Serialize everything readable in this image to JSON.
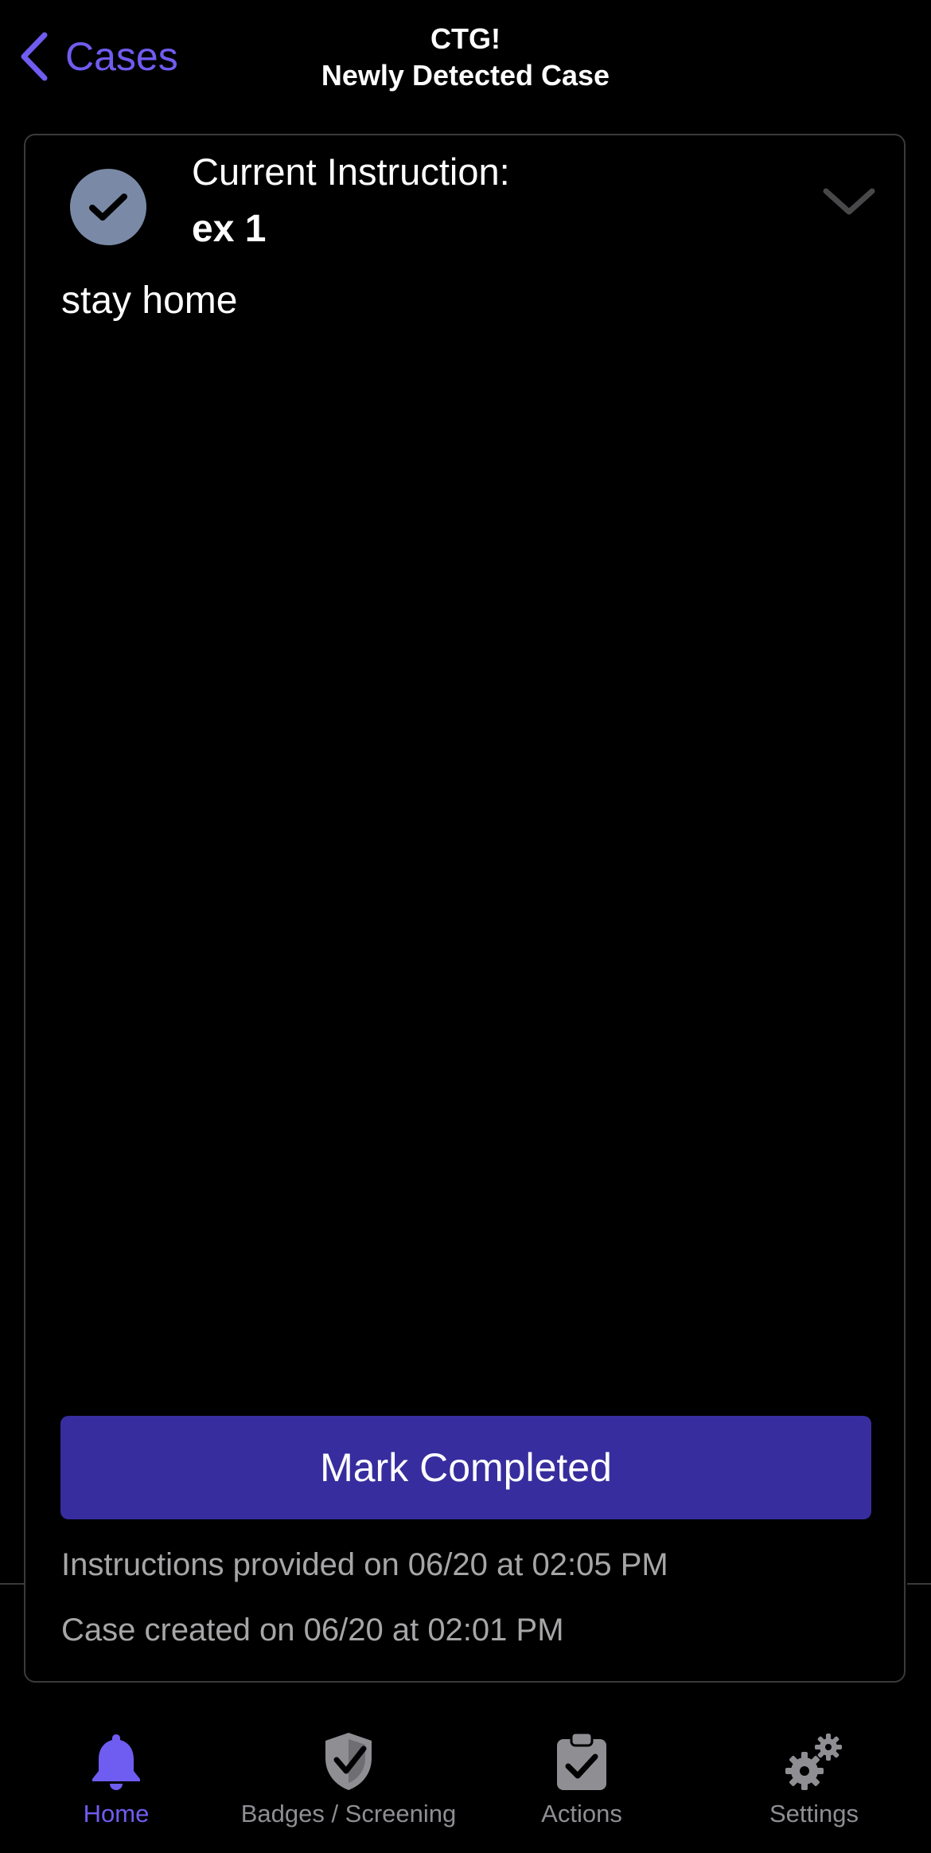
{
  "header": {
    "back_label": "Cases",
    "title_line1": "CTG!",
    "title_line2": "Newly Detected Case"
  },
  "card": {
    "heading": "Current Instruction:",
    "instruction_name": "ex 1",
    "instruction_body": "stay home",
    "mark_button_label": "Mark Completed",
    "instructions_provided": "Instructions provided on 06/20 at 02:05 PM",
    "case_created": "Case created on 06/20 at 02:01 PM"
  },
  "tabbar": {
    "tabs": [
      {
        "label": "Home",
        "icon": "bell-icon",
        "active": true
      },
      {
        "label": "Badges / Screening",
        "icon": "shield-check-icon",
        "active": false
      },
      {
        "label": "Actions",
        "icon": "clipboard-check-icon",
        "active": false
      },
      {
        "label": "Settings",
        "icon": "gears-icon",
        "active": false
      }
    ]
  },
  "colors": {
    "accent": "#6f5cf0",
    "button": "#372d9e",
    "check_circle": "#7a8aa6",
    "inactive": "#8e8e93"
  }
}
